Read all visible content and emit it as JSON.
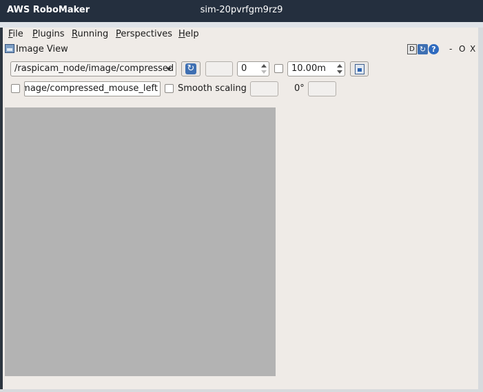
{
  "app": {
    "brand": "AWS RoboMaker",
    "sim_name": "sim-20pvrfgm9rz9"
  },
  "menu": [
    {
      "label": "File",
      "mnemonic": "F",
      "rest": "ile"
    },
    {
      "label": "Plugins",
      "mnemonic": "P",
      "rest": "lugins"
    },
    {
      "label": "Running",
      "mnemonic": "R",
      "rest": "unning"
    },
    {
      "label": "Perspectives",
      "mnemonic": "P",
      "rest": "erspectives"
    },
    {
      "label": "Help",
      "mnemonic": "H",
      "rest": "elp"
    }
  ],
  "plugin": {
    "title": "Image View",
    "dock_d": "D",
    "dock_minus": "-",
    "dock_o": "O",
    "dock_x": "X",
    "help_glyph": "?"
  },
  "toolbar": {
    "topic_selected": "/raspicam_node/image/compressed",
    "spin_value": "0",
    "max_range": "10.00m"
  },
  "row2": {
    "mouse_topic": "e/image/compressed_mouse_left",
    "smooth_scaling": "Smooth scaling",
    "rotation": "0°"
  },
  "icons": {
    "plugin_icon": "image-icon",
    "refresh": "refresh-icon",
    "save": "save-icon",
    "help": "help-icon",
    "combo_arrow": "chevron-down-icon"
  },
  "colors": {
    "titlebar": "#242f3e",
    "window_bg": "#efebe7",
    "canvas": "#b3b3b3",
    "accent": "#3e6fb2"
  }
}
